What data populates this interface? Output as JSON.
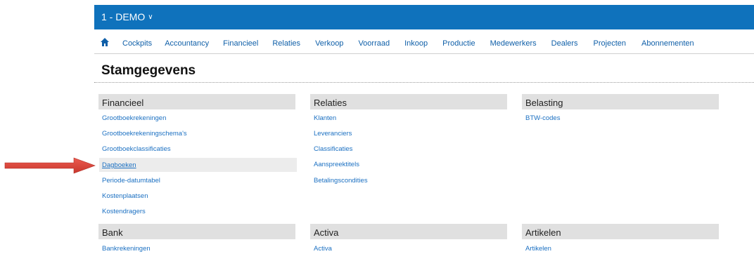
{
  "company": {
    "name": "1 - DEMO",
    "chevron": "∨"
  },
  "nav": {
    "home_icon": "home-icon",
    "items": [
      "Cockpits",
      "Accountancy",
      "Financieel",
      "Relaties",
      "Verkoop",
      "Voorraad",
      "Inkoop",
      "Productie",
      "Medewerkers",
      "Dealers",
      "Projecten",
      "Abonnementen"
    ]
  },
  "page": {
    "title": "Stamgegevens"
  },
  "sections": {
    "financieel": {
      "title": "Financieel",
      "items": [
        "Grootboekrekeningen",
        "Grootboekrekeningschema's",
        "Grootboekclassificaties",
        "Dagboeken",
        "Periode-datumtabel",
        "Kostenplaatsen",
        "Kostendragers"
      ]
    },
    "relaties": {
      "title": "Relaties",
      "items": [
        "Klanten",
        "Leveranciers",
        "Classificaties",
        "Aanspreektitels",
        "Betalingscondities"
      ]
    },
    "belasting": {
      "title": "Belasting",
      "items": [
        "BTW-codes"
      ]
    },
    "bank": {
      "title": "Bank",
      "items": [
        "Bankrekeningen"
      ]
    },
    "activa": {
      "title": "Activa",
      "items": [
        "Activa"
      ]
    },
    "artikelen": {
      "title": "Artikelen",
      "items": [
        "Artikelen"
      ]
    }
  },
  "colors": {
    "brand": "#0f72bc",
    "link": "#1b70c2",
    "arrow": "#e0453a"
  }
}
